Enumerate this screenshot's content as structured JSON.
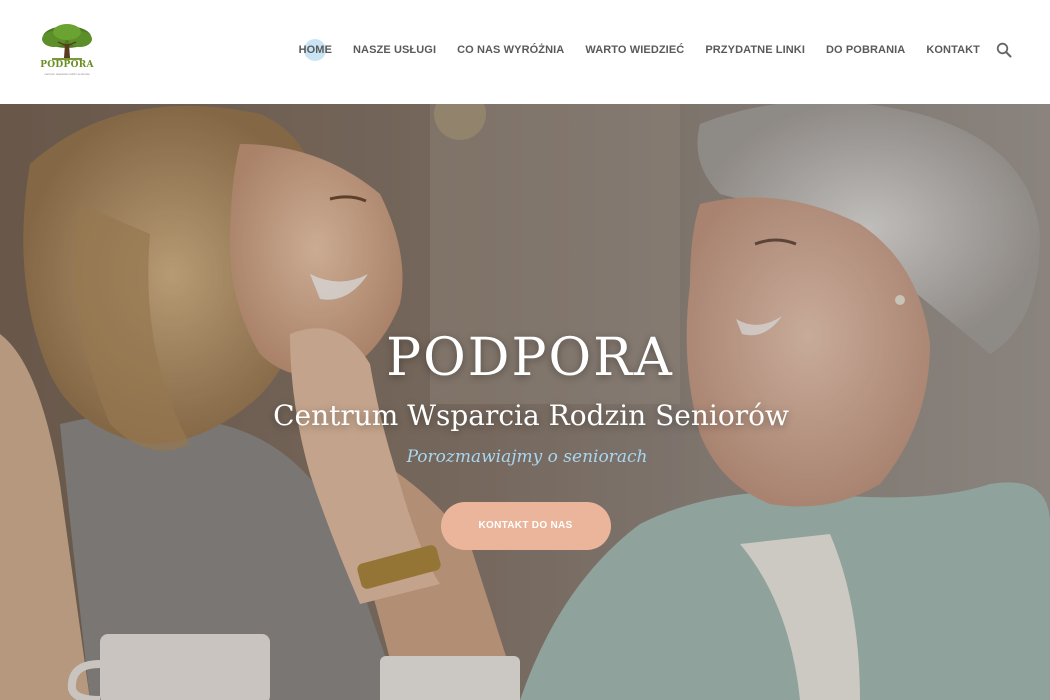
{
  "brand": {
    "name": "PODPORA",
    "tagline": "centrum wsparcia rodzin seniorów"
  },
  "nav": {
    "items": [
      {
        "label": "HOME",
        "active": true
      },
      {
        "label": "NASZE USŁUGI",
        "active": false
      },
      {
        "label": "CO NAS WYRÓŻNIA",
        "active": false
      },
      {
        "label": "WARTO WIEDZIEĆ",
        "active": false
      },
      {
        "label": "PRZYDATNE LINKI",
        "active": false
      },
      {
        "label": "DO POBRANIA",
        "active": false
      },
      {
        "label": "KONTAKT",
        "active": false
      }
    ],
    "search_icon": "search-icon"
  },
  "hero": {
    "title": "PODPORA",
    "subtitle": "Centrum Wsparcia Rodzin Seniorów",
    "tagline": "Porozmawiajmy o seniorach",
    "cta_label": "KONTAKT DO NAS"
  },
  "colors": {
    "accent": "#eab59a",
    "tagline": "#a9d6f0",
    "logo_green": "#6b8e23",
    "nav_text": "#5a5a5a",
    "active_highlight": "#87c4e6"
  }
}
